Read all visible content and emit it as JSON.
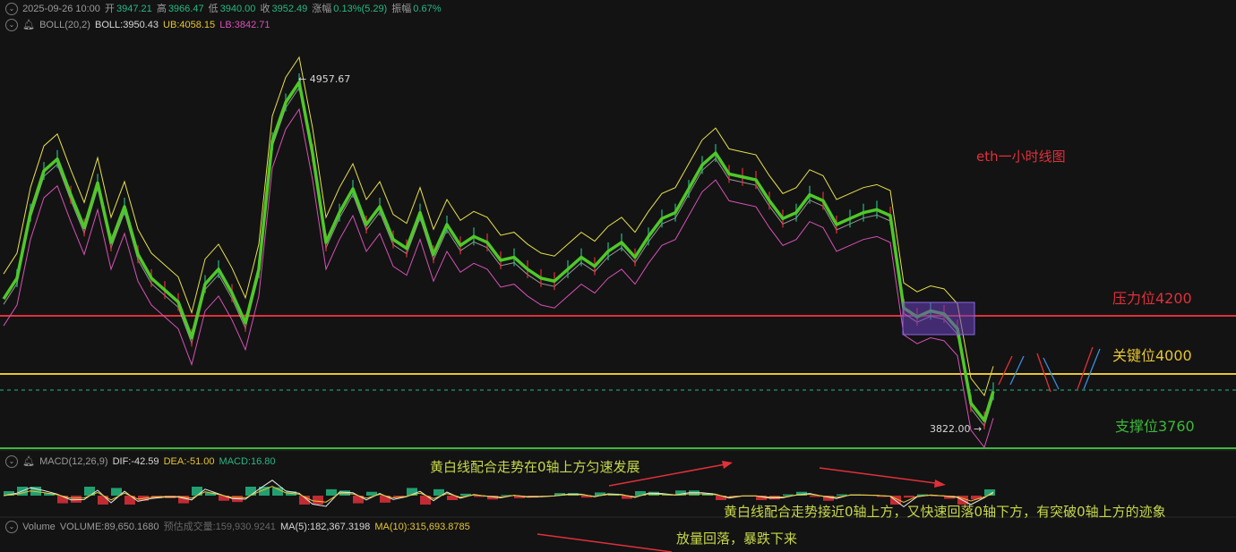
{
  "header": {
    "ohlc_row": {
      "datetime": "2025-09-26 10:00",
      "open_label": "开",
      "open": "3947.21",
      "high_label": "高",
      "high": "3966.47",
      "low_label": "低",
      "low": "3940.00",
      "close_label": "收",
      "close": "3952.49",
      "change_label": "涨幅",
      "change": "0.13%(5.29)",
      "amplitude_label": "振幅",
      "amplitude": "0.67%"
    },
    "boll_row": {
      "name": "BOLL(20,2)",
      "boll": "BOLL:3950.43",
      "ub": "UB:4058.15",
      "lb": "LB:3842.71"
    }
  },
  "macd_row": {
    "name": "MACD(12,26,9)",
    "dif": "DIF:-42.59",
    "dea": "DEA:-51.00",
    "macd": "MACD:16.80"
  },
  "volume_row": {
    "name": "Volume",
    "volume": "VOLUME:89,650.1680",
    "est": "预估成交量:159,930.9241",
    "ma5": "MA(5):182,367.3198",
    "ma10": "MA(10):315,693.8785"
  },
  "annotations": {
    "title": "eth一小时线图",
    "resistance": "压力位4200",
    "key": "关键位4000",
    "support": "支撑位3760",
    "macd_note1": "黄白线配合走势在0轴上方匀速发展",
    "macd_note2": "黄白线配合走势接近0轴上方，又快速回落0轴下方，有突破0轴上方的迹象",
    "volume_note": "放量回落，暴跌下来",
    "high_marker": "← 4957.67",
    "low_marker": "3822.00 →"
  },
  "colors": {
    "background": "#131313",
    "price_line": "#4fc828",
    "upper_band": "#e6e04a",
    "lower_band": "#d651b6",
    "middle_band": "#cfcfcf",
    "resistance": "#e0303a",
    "key_level": "#e6c532",
    "support": "#3db83a",
    "macd_up": "#26b883",
    "macd_down": "#e0303a",
    "title_red": "#e0303a"
  },
  "chart_data": {
    "type": "line",
    "title": "eth一小时线图",
    "series": [],
    "x": [
      0,
      15,
      30,
      45,
      60,
      75,
      90,
      105,
      120,
      135,
      150,
      165,
      180,
      195,
      210,
      225,
      240,
      255,
      270,
      285,
      300,
      315,
      330,
      345,
      360,
      375,
      390,
      405,
      420,
      435,
      450,
      465,
      480,
      495,
      510,
      525,
      540,
      555,
      570,
      585,
      600,
      615,
      630,
      645,
      660,
      675,
      690,
      705,
      720,
      735,
      750,
      765,
      780,
      795,
      810,
      825,
      840,
      855,
      870,
      885,
      900,
      915,
      930,
      945,
      960,
      975,
      990,
      1005,
      1020,
      1035,
      1050,
      1065,
      1080,
      1095,
      1105
    ],
    "price": [
      4230,
      4300,
      4520,
      4660,
      4700,
      4580,
      4470,
      4620,
      4420,
      4540,
      4380,
      4300,
      4260,
      4220,
      4100,
      4280,
      4330,
      4250,
      4150,
      4330,
      4760,
      4890,
      4957.67,
      4720,
      4420,
      4520,
      4600,
      4480,
      4540,
      4430,
      4400,
      4520,
      4380,
      4480,
      4410,
      4440,
      4420,
      4360,
      4370,
      4330,
      4300,
      4290,
      4330,
      4370,
      4340,
      4390,
      4420,
      4370,
      4440,
      4500,
      4520,
      4600,
      4680,
      4720,
      4650,
      4640,
      4630,
      4560,
      4500,
      4520,
      4580,
      4560,
      4480,
      4500,
      4520,
      4530,
      4510,
      4200,
      4170,
      4190,
      4180,
      4130,
      3880,
      3822,
      3920
    ],
    "key_levels": [
      {
        "label": "压力位4200",
        "value": 4200
      },
      {
        "label": "关键位4000",
        "value": 4000
      },
      {
        "label": "支撑位3760",
        "value": 3760
      }
    ],
    "ylim": [
      3760,
      5100
    ],
    "grid": false
  }
}
